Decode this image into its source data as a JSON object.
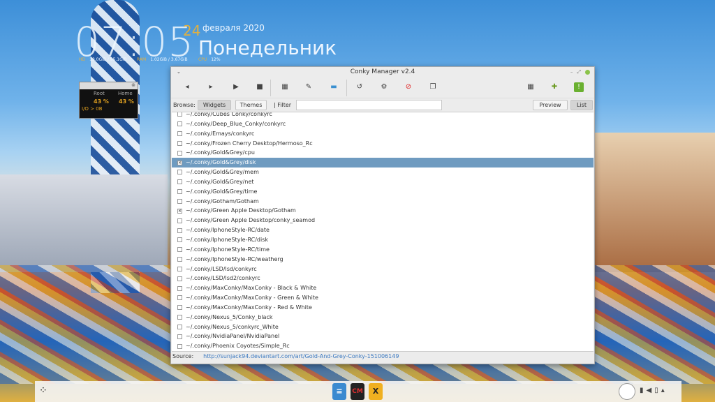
{
  "desktop": {
    "time": "07:05",
    "day": "24",
    "month_year": "февраля 2020",
    "weekday": "Понедельник",
    "stats": [
      {
        "label": "HD",
        "value": "13.0GiB / 95.1GiB"
      },
      {
        "label": "RAM",
        "value": "1.02GiB / 3.67GiB"
      },
      {
        "label": "CPU",
        "value": "12%"
      }
    ],
    "disk_widget": {
      "root_label": "Root",
      "root_pct": "43 %",
      "home_label": "Home",
      "home_pct": "43 %",
      "io": "I/O > 0B"
    }
  },
  "window": {
    "title": "Conky Manager v2.4",
    "toolbar": [
      "back",
      "forward",
      "play",
      "stop",
      "edit-theme",
      "edit",
      "folder",
      "refresh",
      "settings",
      "kill",
      "clone",
      "theme-settings",
      "donate",
      "about"
    ],
    "browse_label": "Browse:",
    "widgets_label": "Widgets",
    "themes_label": "Themes",
    "filter_label": "| Filter",
    "filter_value": "",
    "preview_label": "Preview",
    "list_label": "List",
    "items": [
      {
        "path": "~/.conky/Cubes Conky/conkyrc",
        "checked": false
      },
      {
        "path": "~/.conky/Deep_Blue_Conky/conkyrc",
        "checked": false
      },
      {
        "path": "~/.conky/Emays/conkyrc",
        "checked": false
      },
      {
        "path": "~/.conky/Frozen Cherry Desktop/Hermoso_Rc",
        "checked": false
      },
      {
        "path": "~/.conky/Gold&Grey/cpu",
        "checked": false
      },
      {
        "path": "~/.conky/Gold&Grey/disk",
        "checked": true,
        "selected": true
      },
      {
        "path": "~/.conky/Gold&Grey/mem",
        "checked": false
      },
      {
        "path": "~/.conky/Gold&Grey/net",
        "checked": false
      },
      {
        "path": "~/.conky/Gold&Grey/time",
        "checked": false
      },
      {
        "path": "~/.conky/Gotham/Gotham",
        "checked": false
      },
      {
        "path": "~/.conky/Green Apple Desktop/Gotham",
        "checked": true
      },
      {
        "path": "~/.conky/Green Apple Desktop/conky_seamod",
        "checked": false
      },
      {
        "path": "~/.conky/IphoneStyle-RC/date",
        "checked": false
      },
      {
        "path": "~/.conky/IphoneStyle-RC/disk",
        "checked": false
      },
      {
        "path": "~/.conky/IphoneStyle-RC/time",
        "checked": false
      },
      {
        "path": "~/.conky/IphoneStyle-RC/weatherg",
        "checked": false
      },
      {
        "path": "~/.conky/LSD/lsd/conkyrc",
        "checked": false
      },
      {
        "path": "~/.conky/LSD/lsd2/conkyrc",
        "checked": false
      },
      {
        "path": "~/.conky/MaxConky/MaxConky - Black & White",
        "checked": false
      },
      {
        "path": "~/.conky/MaxConky/MaxConky - Green & White",
        "checked": false
      },
      {
        "path": "~/.conky/MaxConky/MaxConky - Red & White",
        "checked": false
      },
      {
        "path": "~/.conky/Nexus_5/Conky_black",
        "checked": false
      },
      {
        "path": "~/.conky/Nexus_5/conkyrc_White",
        "checked": false
      },
      {
        "path": "~/.conky/NvidiaPanel/NvidiaPanel",
        "checked": false
      },
      {
        "path": "~/.conky/Phoenix Coyotes/Simple_Rc",
        "checked": false
      }
    ],
    "source_label": "Source:",
    "source_url": "http://sunjack94.deviantart.com/art/Gold-And-Grey-Conky-151006149"
  },
  "taskbar": {
    "apps": [
      {
        "name": "document",
        "glyph": "≡",
        "color": "#3a8ad0"
      },
      {
        "name": "conky-manager",
        "glyph": "CM",
        "color": "#222"
      },
      {
        "name": "xapp",
        "glyph": "X",
        "color": "#f0b020"
      }
    ]
  },
  "colors": {
    "selection": "#6f9bc0",
    "accent": "#e0b040",
    "link": "#3a78c0"
  }
}
